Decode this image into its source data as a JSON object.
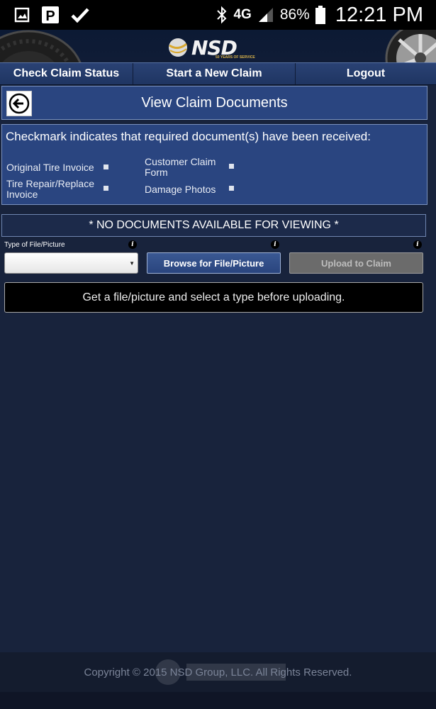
{
  "status_bar": {
    "network": "4G",
    "battery": "86%",
    "time": "12:21 PM"
  },
  "header": {
    "logo_text": "NSD",
    "logo_tagline": "50 YEARS OF SERVICE"
  },
  "nav": {
    "check_status": "Check Claim Status",
    "new_claim": "Start a New Claim",
    "logout": "Logout"
  },
  "page": {
    "title": "View Claim Documents"
  },
  "checklist": {
    "header": "Checkmark indicates that required document(s) have been received:",
    "items": [
      {
        "line1": "Original Tire Invoice",
        "line2": ""
      },
      {
        "line1": "Customer Claim",
        "line2": "Form"
      },
      {
        "line1": "Tire Repair/Replace",
        "line2": "Invoice"
      },
      {
        "line1": "Damage Photos",
        "line2": ""
      }
    ]
  },
  "documents": {
    "empty_text": "* NO DOCUMENTS AVAILABLE FOR VIEWING *"
  },
  "upload": {
    "type_label": "Type of File/Picture",
    "selected_type": "",
    "browse_label": "Browse for File/Picture",
    "upload_label": "Upload to Claim",
    "message": "Get a file/picture and select a type before uploading."
  },
  "footer": {
    "copyright": "Copyright © 2015 NSD Group, LLC. All Rights Reserved."
  },
  "colors": {
    "page_bg": "#18233c",
    "panel_bg": "#2a4580",
    "nav_bg": "#2a4274",
    "disabled_button": "#6b6b6b"
  }
}
